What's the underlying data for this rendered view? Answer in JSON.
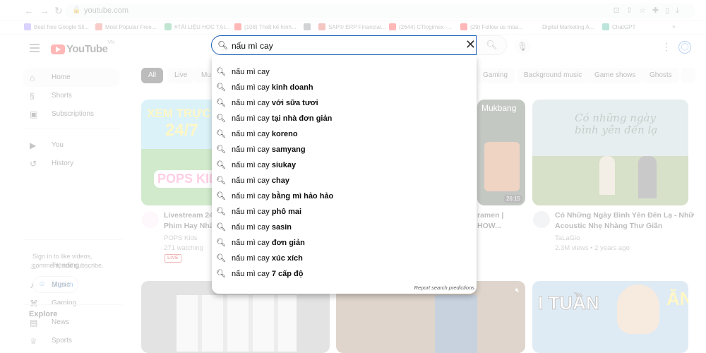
{
  "browser": {
    "url": "youtube.com",
    "bookmarks": [
      {
        "label": "Best free Google Sli...",
        "color": "#7b61ff"
      },
      {
        "label": "Most Popular Free...",
        "color": "#e8453c"
      },
      {
        "label": "#TÀI LIỆU HỌC TẠI...",
        "color": "#1ea362"
      },
      {
        "label": "(108) Thiết kế hình...",
        "color": "#ff0000"
      },
      {
        "label": "",
        "color": "#5f6368"
      },
      {
        "label": "SAP® ERP Financial...",
        "color": "#d93025"
      },
      {
        "label": "(2644) CTlogimex -...",
        "color": "#ff0000"
      },
      {
        "label": "(29) Follow us mùa...",
        "color": "#ff0000"
      },
      {
        "label": "Digital Marketing A...",
        "color": "#ffffff"
      },
      {
        "label": "ChatGPT",
        "color": "#10a37f"
      }
    ],
    "bookmarks_more": "»"
  },
  "header": {
    "logo_text": "YouTube",
    "logo_region": "VN",
    "search_query": "nấu mì cay"
  },
  "sidebar": {
    "items": [
      {
        "label": "Home",
        "icon": "home-icon",
        "glyph": "⌂"
      },
      {
        "label": "Shorts",
        "icon": "shorts-icon",
        "glyph": "§"
      },
      {
        "label": "Subscriptions",
        "icon": "subscriptions-icon",
        "glyph": "▣"
      },
      {
        "label": "You",
        "icon": "you-icon",
        "glyph": "▶"
      },
      {
        "label": "History",
        "icon": "history-icon",
        "glyph": "↺"
      }
    ],
    "signin_text": "Sign in to like videos, comment, and subscribe.",
    "signin_label": "Sign in",
    "explore_title": "Explore",
    "explore": [
      {
        "label": "Trending",
        "icon": "trending-icon",
        "glyph": "♨"
      },
      {
        "label": "Music",
        "icon": "music-icon",
        "glyph": "♪"
      },
      {
        "label": "Gaming",
        "icon": "gaming-icon",
        "glyph": "⌘"
      },
      {
        "label": "News",
        "icon": "news-icon",
        "glyph": "▤"
      },
      {
        "label": "Sports",
        "icon": "sports-icon",
        "glyph": "♕"
      }
    ]
  },
  "chips": [
    "All",
    "Live",
    "Mu",
    "Gaming",
    "Background music",
    "Game shows",
    "Ghosts",
    ""
  ],
  "videos": [
    {
      "title_line1": "Livestream 24",
      "title_line2": "Phim Hay Nhấ",
      "channel": "POPS Kids",
      "stats": "271 watching",
      "badge": "LIVE",
      "thumb_text": "XEM TRỰC T",
      "thumb_text2": "24/7",
      "thumb_logo": "POPS KIDS"
    },
    {
      "title_line1": "ramen |",
      "title_line2": "HOW...",
      "thumb_text": "Mukbang",
      "duration": "26:15"
    },
    {
      "title_line1": "Có Những Ngày Bình Yên Đến Lạ - Nhữ",
      "title_line2": "Acoustic Nhẹ Nhàng Thư Giãn",
      "channel": "TaLaGio",
      "stats": "2.3M views • 2 years ago",
      "thumb_text": "Có những ngày bình yên đến lạ"
    },
    {
      "thumb_text": "I TUẦN",
      "thumb_text2": "ĂN"
    }
  ],
  "suggestions": [
    {
      "prefix": "nấu mì cay",
      "rest": ""
    },
    {
      "prefix": "nấu mì cay",
      "rest": "kinh doanh"
    },
    {
      "prefix": "nấu mì cay",
      "rest": "với sữa tươi"
    },
    {
      "prefix": "nấu mì cay",
      "rest": "tại nhà đơn giản"
    },
    {
      "prefix": "nấu mì cay",
      "rest": "koreno"
    },
    {
      "prefix": "nấu mì cay",
      "rest": "samyang"
    },
    {
      "prefix": "nấu mì cay",
      "rest": "siukay"
    },
    {
      "prefix": "nấu mì cay",
      "rest": "chay"
    },
    {
      "prefix": "nấu mì cay",
      "rest": "bằng mì hảo hảo"
    },
    {
      "prefix": "nấu mì cay",
      "rest": "phô mai"
    },
    {
      "prefix": "nấu mì cay",
      "rest": "sasin"
    },
    {
      "prefix": "nấu mì cay",
      "rest": "đơn giản"
    },
    {
      "prefix": "nấu mì cay",
      "rest": "xúc xích"
    },
    {
      "prefix": "nấu mì cay",
      "rest": "7 cấp độ"
    }
  ],
  "report_label": "Report search predictions",
  "colors": {
    "accent": "#065fd4",
    "brand": "#ff0000",
    "search_border": "#1c62b9"
  }
}
